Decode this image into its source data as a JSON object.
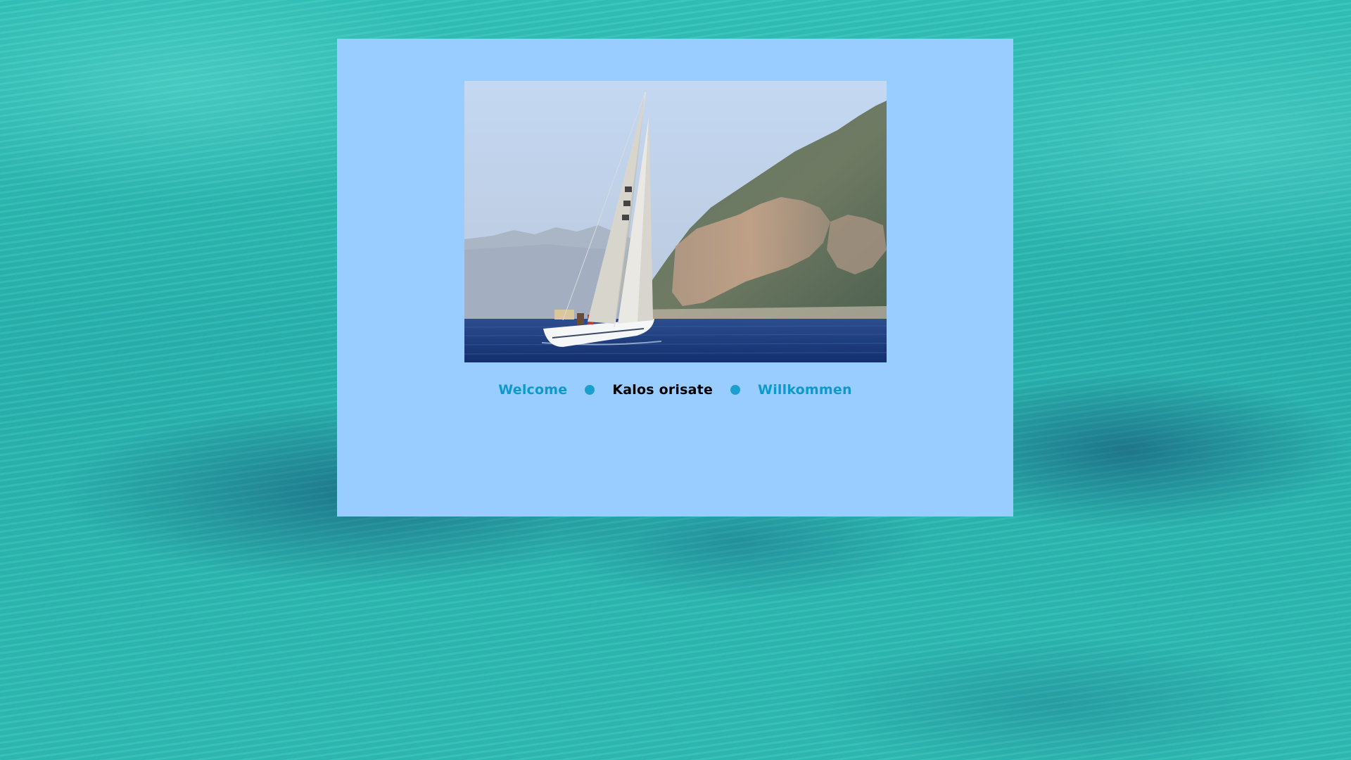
{
  "background": {
    "image": "turquoise-sea-water",
    "color": "#2cb9b2"
  },
  "panel": {
    "color": "#99ccff"
  },
  "hero_image": {
    "alt": "sailboat-on-sea"
  },
  "nav": {
    "items": [
      {
        "label": "Welcome",
        "current": false
      },
      {
        "label": "Kalos orisate",
        "current": true
      },
      {
        "label": "Willkommen",
        "current": false
      }
    ],
    "link_color": "#0b9acb",
    "current_color": "#000000",
    "separator_icon": "bullet-dot-icon"
  }
}
